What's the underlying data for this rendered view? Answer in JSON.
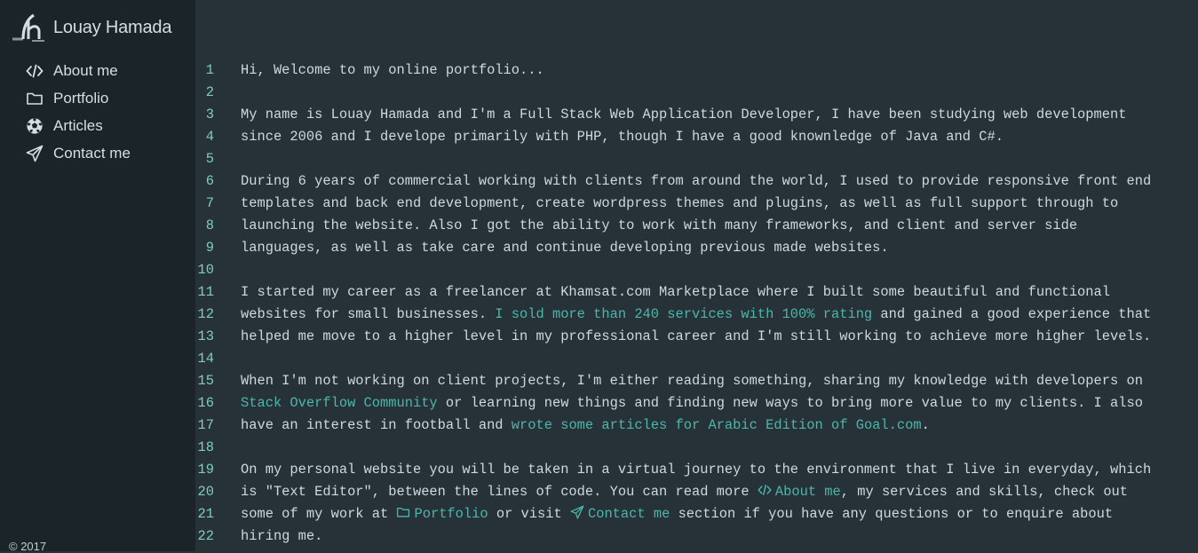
{
  "brand": {
    "name": "Louay Hamada",
    "logo_icon": "logo-icon"
  },
  "nav": [
    {
      "label": "About me",
      "icon": "code-icon"
    },
    {
      "label": "Portfolio",
      "icon": "folder-icon"
    },
    {
      "label": "Articles",
      "icon": "football-icon"
    },
    {
      "label": "Contact me",
      "icon": "paper-plane-icon"
    }
  ],
  "footer": {
    "copyright": "© 2017"
  },
  "editor": {
    "lines": [
      {
        "n": "1",
        "t": "Hi, Welcome to my online portfolio..."
      },
      {
        "n": "2",
        "t": ""
      },
      {
        "n": "3",
        "t": "My name is Louay Hamada and I'm a Full Stack Web Application Developer, I have been studying web development"
      },
      {
        "n": "4",
        "t": "since 2006 and I develope primarily with PHP, though I have a good knownledge of Java and C#."
      },
      {
        "n": "5",
        "t": ""
      },
      {
        "n": "6",
        "t": "During 6 years of commercial working with clients from around the world, I used to provide responsive front end"
      },
      {
        "n": "7",
        "t": "templates and back end development, create wordpress themes and plugins, as well as full support through to"
      },
      {
        "n": "8",
        "t": "launching the website. Also I got the ability to work with many frameworks, and client and server side"
      },
      {
        "n": "9",
        "t": "languages, as well as take care and continue developing previous made websites."
      },
      {
        "n": "10",
        "t": ""
      },
      {
        "n": "11",
        "t": "I started my career as a freelancer at Khamsat.com Marketplace where I built some beautiful and functional"
      },
      {
        "n": "12",
        "t1": "websites for small businesses. ",
        "link": "I sold more than 240 services with 100% rating",
        "t2": " and gained a good experience that"
      },
      {
        "n": "13",
        "t": "helped me move to a higher level in my professional career and I'm still working to achieve more higher levels."
      },
      {
        "n": "14",
        "t": ""
      },
      {
        "n": "15",
        "t": "When I'm not working on client projects, I'm either reading something, sharing my knowledge with developers on"
      },
      {
        "n": "16",
        "link": "Stack Overflow Community",
        "t2": " or learning new things and finding new ways to bring more value to my clients. I also"
      },
      {
        "n": "17",
        "t1": "have an interest in football and ",
        "link": "wrote some articles for Arabic Edition of Goal.com",
        "t2": "."
      },
      {
        "n": "18",
        "t": ""
      },
      {
        "n": "19",
        "t": "On my personal website you will be taken in a virtual journey to the environment that I live in everyday, which"
      },
      {
        "n": "20",
        "t1": "is \"Text Editor\", between the lines of code. You can read more ",
        "link": "About me",
        "link_icon": "code-icon",
        "t2": ", my services and skills, check out"
      },
      {
        "n": "21",
        "t1": "some of my work at ",
        "link": "Portfolio",
        "link_icon": "folder-icon",
        "t2": " or visit ",
        "link2": "Contact me",
        "link2_icon": "paper-plane-icon",
        "t3": " section if you have any questions or to enquire about"
      },
      {
        "n": "22",
        "t": "hiring me."
      }
    ]
  },
  "colors": {
    "editor_bg": "#263238",
    "sidebar_bg": "#1b2428",
    "text": "#cfd8dc",
    "line_number": "#80cbc4",
    "link": "#4db6ac"
  }
}
